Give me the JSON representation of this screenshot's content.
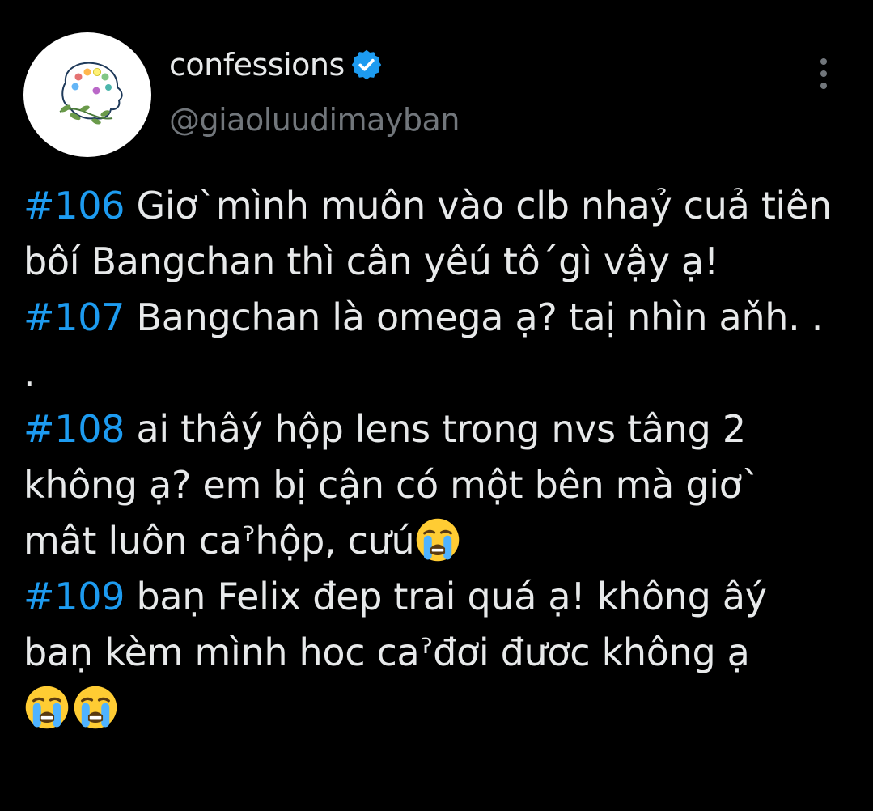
{
  "profile": {
    "display_name": "confessions",
    "handle": "@giaoluudimayban",
    "verified": true,
    "avatar_icon": "palette-head-logo-icon",
    "verified_icon": "verified-badge-icon",
    "verified_color": "#1d9bf0"
  },
  "more_menu": {
    "icon": "more-vertical-icon"
  },
  "colors": {
    "background": "#000000",
    "text": "#e7e9ea",
    "secondary_text": "#71767b",
    "hashtag": "#1d9bf0"
  },
  "post": {
    "entries": [
      {
        "tag": "#106",
        "text": " Giơ`mình muôn vào clb nhaỷ cuả tiên bôí Bangchan thì cân yêú tô´gì vậy ạ!"
      },
      {
        "tag": "#107",
        "text": " Bangchan là omega ạ?  taị nhìn aňh. . ."
      },
      {
        "tag": "#108",
        "text": " ai thâý hộp lens trong nvs tâng 2 không ạ?  em bị cận có một bên mà giơ` mât luôn caˀhộp, cưú"
      },
      {
        "tag": "#109",
        "text": " baṇ Felix đep trai quá ạ! không âý baṇ kèm mình hoc caˀđơi đươc không ạ"
      }
    ],
    "emoji_icon": "loudly-crying-face-icon"
  }
}
